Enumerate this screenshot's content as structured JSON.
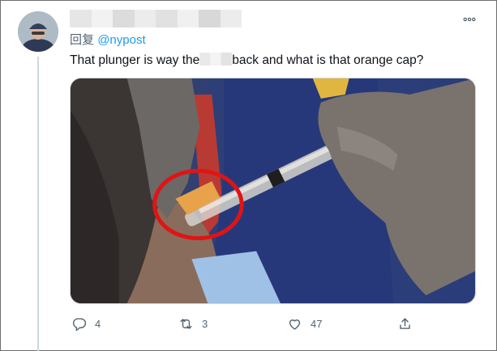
{
  "tweet": {
    "reply_prefix": "回复",
    "reply_handle": "@nypost",
    "text_before": "That plunger is way the",
    "text_after": "back and what is that orange cap?"
  },
  "actions": {
    "reply_count": "4",
    "retweet_count": "3",
    "like_count": "47"
  },
  "icons": {
    "more": "more-horizontal-icon",
    "reply": "reply-icon",
    "retweet": "retweet-icon",
    "like": "heart-icon",
    "share": "share-icon"
  },
  "colors": {
    "link": "#1d9bf0",
    "secondary_text": "#536471",
    "annotation_circle": "#e01414"
  }
}
